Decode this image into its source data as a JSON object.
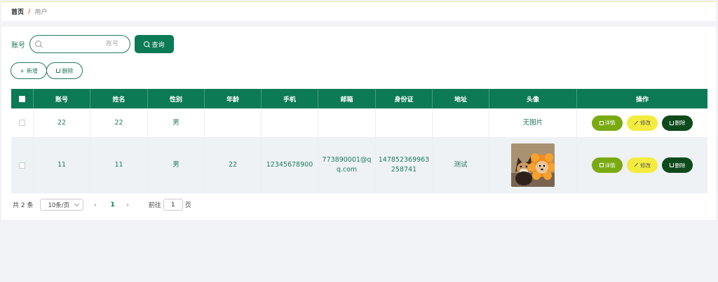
{
  "breadcrumb": {
    "home": "首页",
    "separator": "/",
    "current": "用户"
  },
  "search": {
    "label": "账号",
    "placeholder": "账号",
    "value": "",
    "query_label": "查询"
  },
  "actions": {
    "add_label": "新增",
    "delete_label": "删除"
  },
  "table": {
    "headers": [
      "账号",
      "姓名",
      "性别",
      "年龄",
      "手机",
      "邮箱",
      "身份证",
      "地址",
      "头像",
      "操作"
    ],
    "rows": [
      {
        "account": "22",
        "name": "22",
        "gender": "男",
        "age": "",
        "phone": "",
        "email": "",
        "id_card": "",
        "address": "",
        "avatar_text": "无图片"
      },
      {
        "account": "11",
        "name": "11",
        "gender": "男",
        "age": "22",
        "phone": "12345678900",
        "email": "773890001@qq.com",
        "id_card": "147852369963258741",
        "address": "测试",
        "avatar_text": ""
      }
    ],
    "op_labels": {
      "detail": "详情",
      "edit": "修改",
      "delete": "删除"
    }
  },
  "pagination": {
    "total": "共 2 条",
    "page_size": "10条/页",
    "current_page": "1",
    "goto_label": "前往",
    "goto_value": "1",
    "page_suffix": "页"
  },
  "colors": {
    "primary": "#0b7a55",
    "detail": "#7aaa12",
    "edit": "#f3ec3f",
    "delete": "#0e4a1c"
  },
  "icons": [
    "search-icon",
    "plus-icon",
    "trash-icon",
    "detail-icon",
    "pen-icon",
    "chevron-down-icon",
    "chevron-left-icon",
    "chevron-right-icon"
  ]
}
